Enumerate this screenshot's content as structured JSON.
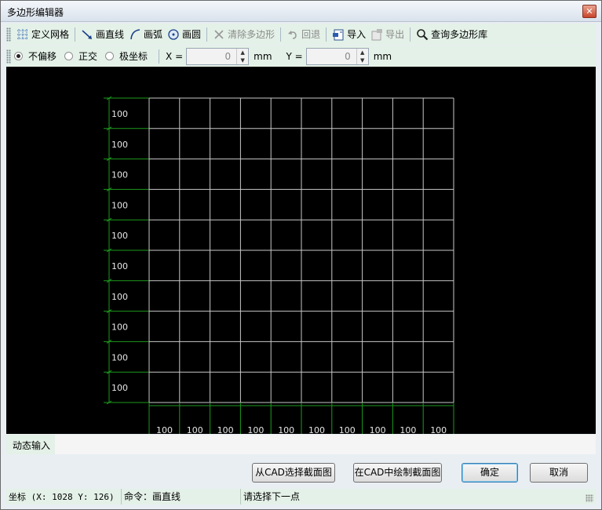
{
  "window": {
    "title": "多边形编辑器",
    "close_glyph": "✕"
  },
  "toolbar1": {
    "define_grid": "定义网格",
    "draw_line": "画直线",
    "draw_arc": "画弧",
    "draw_circle": "画圆",
    "clear_polygon": "清除多边形",
    "undo": "回退",
    "import": "导入",
    "export": "导出",
    "query_library": "查询多边形库"
  },
  "toolbar2": {
    "mode_none": "不偏移",
    "mode_ortho": "正交",
    "mode_polar": "极坐标",
    "selected_mode": "不偏移",
    "x_label": "X =",
    "x_value": "0",
    "x_unit": "mm",
    "y_label": "Y =",
    "y_value": "0",
    "y_unit": "mm"
  },
  "grid": {
    "rows": 10,
    "cols": 10,
    "row_labels": [
      "100",
      "100",
      "100",
      "100",
      "100",
      "100",
      "100",
      "100",
      "100",
      "100"
    ],
    "col_labels": [
      "100",
      "100",
      "100",
      "100",
      "100",
      "100",
      "100",
      "100",
      "100",
      "100"
    ],
    "grid_color": "#c8c8c8",
    "dim_color": "#1e9a1e",
    "label_color": "#e6e6e6"
  },
  "dynamic_input": {
    "tab_label": "动态输入"
  },
  "buttons": {
    "select_from_cad": "从CAD选择截面图",
    "draw_in_cad": "在CAD中绘制截面图",
    "ok": "确定",
    "cancel": "取消"
  },
  "status": {
    "coords": "坐标 (X: 1028 Y: 126)",
    "command": "命令：画直线",
    "prompt": "请选择下一点"
  }
}
